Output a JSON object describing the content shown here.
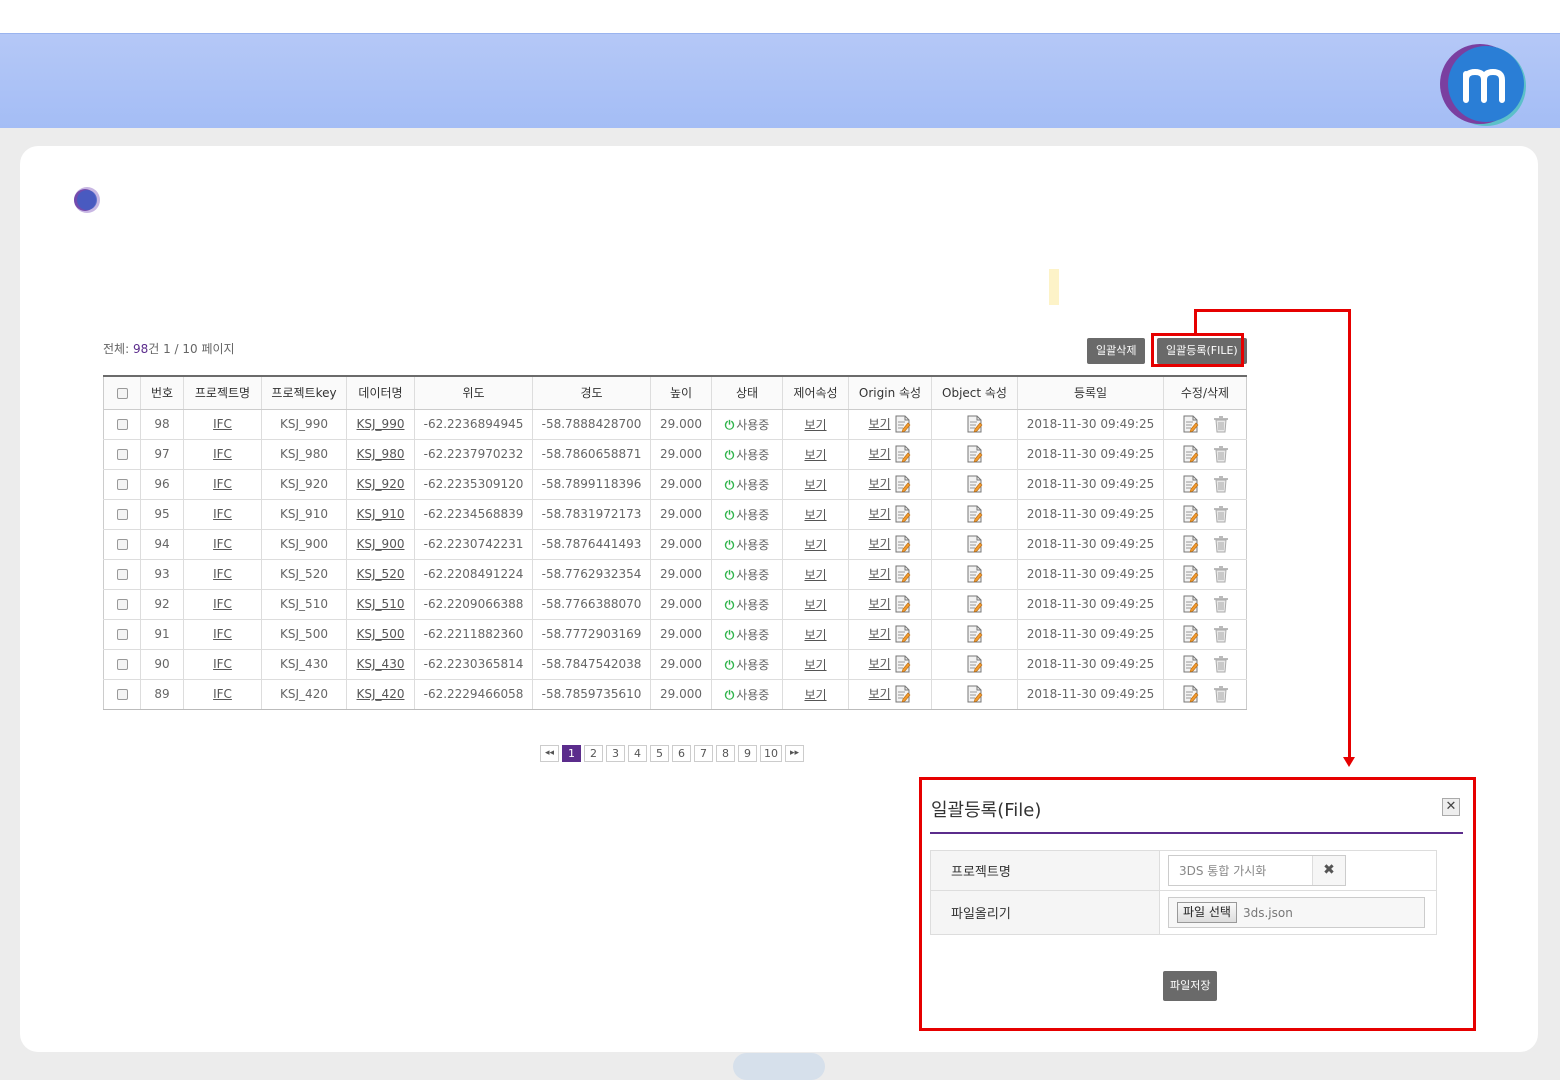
{
  "summary": {
    "prefix": "전체: ",
    "total": "98",
    "suffix": "건 1 / 10 페이지"
  },
  "buttons": {
    "delete_all": "일괄삭제",
    "bulk_file": "일괄등록(FILE)"
  },
  "table": {
    "columns": [
      "",
      "번호",
      "프로젝트명",
      "프로젝트key",
      "데이터명",
      "위도",
      "경도",
      "높이",
      "상태",
      "제어속성",
      "Origin 속성",
      "Object 속성",
      "등록일",
      "수정/삭제"
    ],
    "view_label": "보기",
    "rows": [
      {
        "no": "98",
        "project": "IFC",
        "key": "KSJ_990",
        "name": "KSJ_990",
        "lat": "-62.2236894945",
        "lon": "-58.7888428700",
        "height": "29.000",
        "status": "사용중",
        "date": "2018-11-30 09:49:25"
      },
      {
        "no": "97",
        "project": "IFC",
        "key": "KSJ_980",
        "name": "KSJ_980",
        "lat": "-62.2237970232",
        "lon": "-58.7860658871",
        "height": "29.000",
        "status": "사용중",
        "date": "2018-11-30 09:49:25"
      },
      {
        "no": "96",
        "project": "IFC",
        "key": "KSJ_920",
        "name": "KSJ_920",
        "lat": "-62.2235309120",
        "lon": "-58.7899118396",
        "height": "29.000",
        "status": "사용중",
        "date": "2018-11-30 09:49:25"
      },
      {
        "no": "95",
        "project": "IFC",
        "key": "KSJ_910",
        "name": "KSJ_910",
        "lat": "-62.2234568839",
        "lon": "-58.7831972173",
        "height": "29.000",
        "status": "사용중",
        "date": "2018-11-30 09:49:25"
      },
      {
        "no": "94",
        "project": "IFC",
        "key": "KSJ_900",
        "name": "KSJ_900",
        "lat": "-62.2230742231",
        "lon": "-58.7876441493",
        "height": "29.000",
        "status": "사용중",
        "date": "2018-11-30 09:49:25"
      },
      {
        "no": "93",
        "project": "IFC",
        "key": "KSJ_520",
        "name": "KSJ_520",
        "lat": "-62.2208491224",
        "lon": "-58.7762932354",
        "height": "29.000",
        "status": "사용중",
        "date": "2018-11-30 09:49:25"
      },
      {
        "no": "92",
        "project": "IFC",
        "key": "KSJ_510",
        "name": "KSJ_510",
        "lat": "-62.2209066388",
        "lon": "-58.7766388070",
        "height": "29.000",
        "status": "사용중",
        "date": "2018-11-30 09:49:25"
      },
      {
        "no": "91",
        "project": "IFC",
        "key": "KSJ_500",
        "name": "KSJ_500",
        "lat": "-62.2211882360",
        "lon": "-58.7772903169",
        "height": "29.000",
        "status": "사용중",
        "date": "2018-11-30 09:49:25"
      },
      {
        "no": "90",
        "project": "IFC",
        "key": "KSJ_430",
        "name": "KSJ_430",
        "lat": "-62.2230365814",
        "lon": "-58.7847542038",
        "height": "29.000",
        "status": "사용중",
        "date": "2018-11-30 09:49:25"
      },
      {
        "no": "89",
        "project": "IFC",
        "key": "KSJ_420",
        "name": "KSJ_420",
        "lat": "-62.2229466058",
        "lon": "-58.7859735610",
        "height": "29.000",
        "status": "사용중",
        "date": "2018-11-30 09:49:25"
      }
    ]
  },
  "pagination": {
    "first": "◂◂",
    "last": "▸▸",
    "pages": [
      "1",
      "2",
      "3",
      "4",
      "5",
      "6",
      "7",
      "8",
      "9",
      "10"
    ],
    "current": "1"
  },
  "dialog": {
    "title": "일괄등록(File)",
    "close_icon": "close-x-icon",
    "project_label": "프로젝트명",
    "project_value": "3DS 통합 가시화",
    "file_label": "파일올리기",
    "file_button": "파일 선택",
    "file_name": "3ds.json",
    "save_button": "파일저장"
  },
  "colors": {
    "accent": "#5b2c8c",
    "header": "#a8c0f6",
    "highlight": "#e60000",
    "status": "#2fb34a"
  }
}
